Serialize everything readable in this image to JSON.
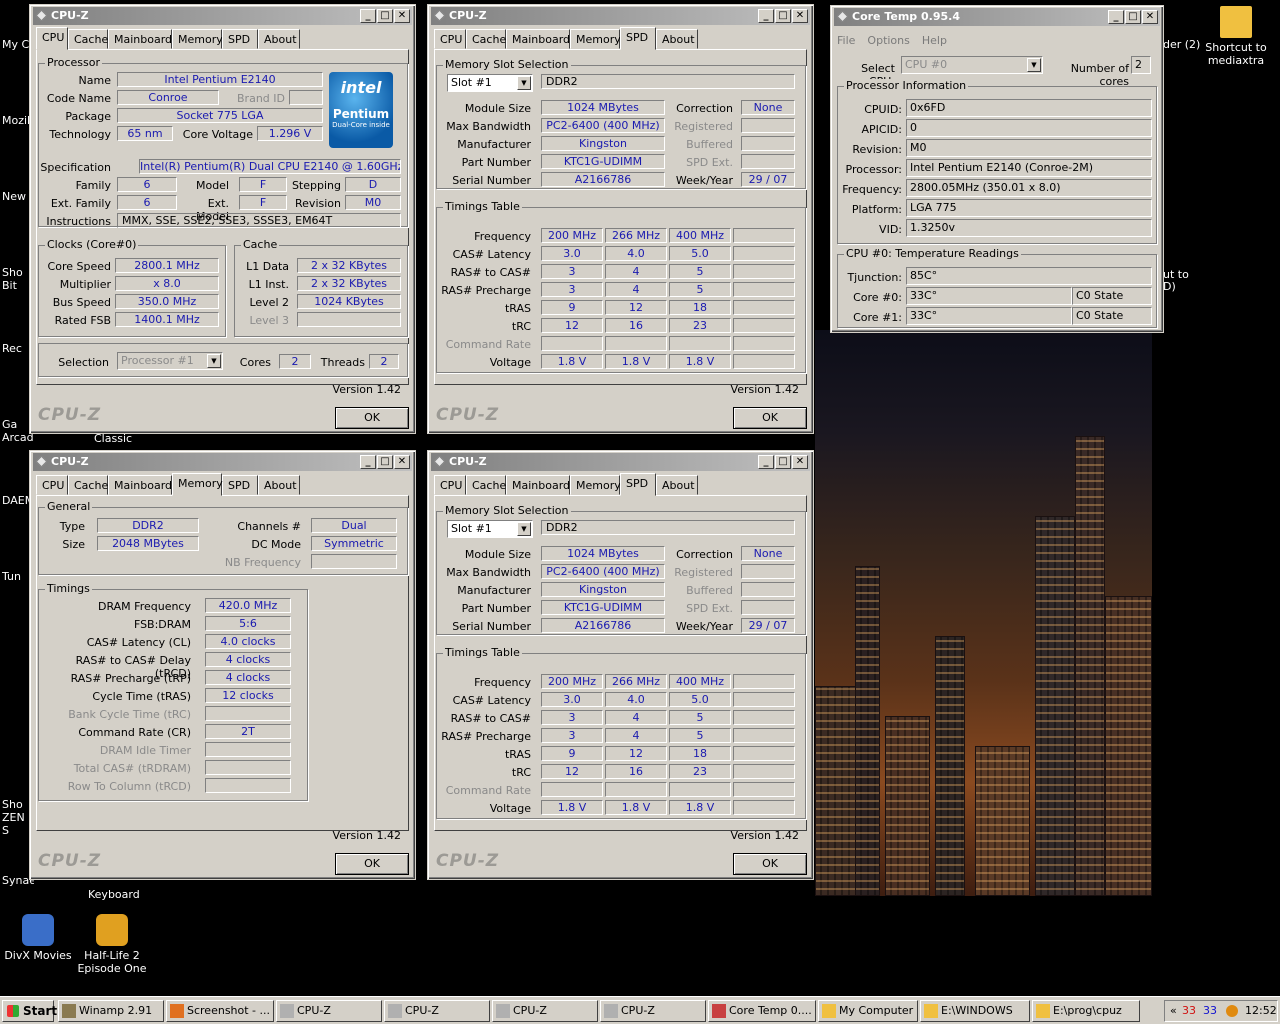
{
  "desktop": {
    "icons": [
      {
        "label": "Shortcut to mediaxtra",
        "icon": "folder-icon"
      },
      {
        "label": "DivX Movies",
        "icon": "divx-icon"
      },
      {
        "label": "Half-Life 2 Episode One",
        "icon": "halflife-icon"
      }
    ],
    "edge_left": [
      "My C",
      "Mozill",
      "New",
      "Sho Bit",
      "Rec",
      "Ga Arcade",
      "DAEM",
      "Tun",
      "Sho ZEN S",
      "Synaesthete"
    ],
    "partial": {
      "classic": "Classic",
      "keyboard": "Keyboard",
      "folder2": "der (2)",
      "shortcut_to": "ut to",
      "d": "D)"
    }
  },
  "cpuz_windows": [
    {
      "title": "CPU-Z",
      "active_tab": "CPU",
      "version": "Version 1.42",
      "brand": "CPU-Z",
      "ok": "OK"
    },
    {
      "title": "CPU-Z",
      "active_tab": "SPD",
      "version": "Version 1.42",
      "brand": "CPU-Z",
      "ok": "OK"
    },
    {
      "title": "CPU-Z",
      "active_tab": "Memory",
      "version": "Version 1.42",
      "brand": "CPU-Z",
      "ok": "OK"
    },
    {
      "title": "CPU-Z",
      "active_tab": "SPD",
      "version": "Version 1.42",
      "brand": "CPU-Z",
      "ok": "OK"
    }
  ],
  "tabs": [
    "CPU",
    "Cache",
    "Mainboard",
    "Memory",
    "SPD",
    "About"
  ],
  "cpu": {
    "processor_group": "Processor",
    "labels": {
      "name": "Name",
      "code_name": "Code Name",
      "brand_id": "Brand ID",
      "package": "Package",
      "technology": "Technology",
      "core_voltage": "Core Voltage",
      "specification": "Specification",
      "family": "Family",
      "model": "Model",
      "stepping": "Stepping",
      "ext_family": "Ext. Family",
      "ext_model": "Ext. Model",
      "revision": "Revision",
      "instructions": "Instructions"
    },
    "name": "Intel Pentium E2140",
    "code_name": "Conroe",
    "brand_id": "",
    "package": "Socket 775 LGA",
    "technology": "65 nm",
    "core_voltage": "1.296 V",
    "specification": "Intel(R) Pentium(R) Dual  CPU  E2140  @ 1.60GHz",
    "family": "6",
    "model": "F",
    "stepping": "D",
    "ext_family": "6",
    "ext_model": "F",
    "revision": "M0",
    "instructions": "MMX, SSE, SSE2, SSE3, SSSE3, EM64T",
    "logo": {
      "brand": "intel",
      "product": "Pentium",
      "sub": "Dual-Core inside"
    },
    "clocks_group": "Clocks (Core#0)",
    "clock_labels": {
      "core_speed": "Core Speed",
      "multiplier": "Multiplier",
      "bus_speed": "Bus Speed",
      "rated_fsb": "Rated FSB"
    },
    "core_speed": "2800.1 MHz",
    "multiplier": "x 8.0",
    "bus_speed": "350.0 MHz",
    "rated_fsb": "1400.1 MHz",
    "cache_group": "Cache",
    "cache_labels": {
      "l1_data": "L1 Data",
      "l1_inst": "L1 Inst.",
      "level2": "Level 2",
      "level3": "Level 3"
    },
    "l1_data": "2 x 32 KBytes",
    "l1_inst": "2 x 32 KBytes",
    "level2": "1024 KBytes",
    "level3": "",
    "selection_label": "Selection",
    "selection": "Processor #1",
    "cores_label": "Cores",
    "cores": "2",
    "threads_label": "Threads",
    "threads": "2"
  },
  "spd": {
    "slot_group": "Memory Slot Selection",
    "slot": "Slot #1",
    "type": "DDR2",
    "labels": {
      "module_size": "Module Size",
      "max_bandwidth": "Max Bandwidth",
      "manufacturer": "Manufacturer",
      "part_number": "Part Number",
      "serial_number": "Serial Number",
      "correction": "Correction",
      "registered": "Registered",
      "buffered": "Buffered",
      "spd_ext": "SPD Ext.",
      "week_year": "Week/Year"
    },
    "module_size": "1024 MBytes",
    "max_bandwidth": "PC2-6400 (400 MHz)",
    "manufacturer": "Kingston",
    "part_number": "KTC1G-UDIMM",
    "serial_number": "A2166786",
    "correction": "None",
    "week_year": "29 / 07",
    "timings_group": "Timings Table",
    "rows": [
      {
        "label": "Frequency",
        "vals": [
          "200 MHz",
          "266 MHz",
          "400 MHz",
          ""
        ]
      },
      {
        "label": "CAS# Latency",
        "vals": [
          "3.0",
          "4.0",
          "5.0",
          ""
        ]
      },
      {
        "label": "RAS# to CAS#",
        "vals": [
          "3",
          "4",
          "5",
          ""
        ]
      },
      {
        "label": "RAS# Precharge",
        "vals": [
          "3",
          "4",
          "5",
          ""
        ]
      },
      {
        "label": "tRAS",
        "vals": [
          "9",
          "12",
          "18",
          ""
        ]
      },
      {
        "label": "tRC",
        "vals": [
          "12",
          "16",
          "23",
          ""
        ]
      },
      {
        "label": "Command Rate",
        "vals": [
          "",
          "",
          "",
          ""
        ],
        "disabled": true
      },
      {
        "label": "Voltage",
        "vals": [
          "1.8 V",
          "1.8 V",
          "1.8 V",
          ""
        ]
      }
    ]
  },
  "memory": {
    "general_group": "General",
    "labels": {
      "type": "Type",
      "size": "Size",
      "channels": "Channels #",
      "dc_mode": "DC Mode",
      "nb_frequency": "NB Frequency"
    },
    "type": "DDR2",
    "size": "2048 MBytes",
    "channels": "Dual",
    "dc_mode": "Symmetric",
    "nb_frequency": "",
    "timings_group": "Timings",
    "rows": [
      {
        "label": "DRAM Frequency",
        "val": "420.0 MHz"
      },
      {
        "label": "FSB:DRAM",
        "val": "5:6"
      },
      {
        "label": "CAS# Latency (CL)",
        "val": "4.0 clocks"
      },
      {
        "label": "RAS# to CAS# Delay (tRCD)",
        "val": "4 clocks"
      },
      {
        "label": "RAS# Precharge (tRP)",
        "val": "4 clocks"
      },
      {
        "label": "Cycle Time (tRAS)",
        "val": "12 clocks"
      },
      {
        "label": "Bank Cycle Time (tRC)",
        "val": "",
        "disabled": true
      },
      {
        "label": "Command Rate (CR)",
        "val": "2T"
      },
      {
        "label": "DRAM Idle Timer",
        "val": "",
        "disabled": true
      },
      {
        "label": "Total CAS# (tRDRAM)",
        "val": "",
        "disabled": true
      },
      {
        "label": "Row To Column (tRCD)",
        "val": "",
        "disabled": true
      }
    ]
  },
  "coretemp": {
    "title": "Core Temp 0.95.4",
    "menu": [
      "File",
      "Options",
      "Help"
    ],
    "select_cpu_label": "Select CPU:",
    "select_cpu": "CPU #0",
    "num_cores_label": "Number of cores",
    "num_cores": "2",
    "info_group": "Processor Information",
    "info": [
      {
        "label": "CPUID:",
        "val": "0x6FD"
      },
      {
        "label": "APICID:",
        "val": "0"
      },
      {
        "label": "Revision:",
        "val": "M0"
      },
      {
        "label": "Processor:",
        "val": "Intel Pentium E2140 (Conroe-2M)"
      },
      {
        "label": "Frequency:",
        "val": "2800.05MHz (350.01 x 8.0)"
      },
      {
        "label": "Platform:",
        "val": "LGA 775"
      },
      {
        "label": "VID:",
        "val": "1.3250v"
      }
    ],
    "temp_group": "CPU #0: Temperature Readings",
    "tjunction_label": "Tjunction:",
    "tjunction": "85C°",
    "cores": [
      {
        "label": "Core #0:",
        "temp": "33C°",
        "state": "C0 State"
      },
      {
        "label": "Core #1:",
        "temp": "33C°",
        "state": "C0 State"
      }
    ]
  },
  "taskbar": {
    "start": "Start",
    "tasks": [
      {
        "label": "Winamp 2.91",
        "icon": "winamp-icon"
      },
      {
        "label": "Screenshot - ...",
        "icon": "firefox-icon"
      },
      {
        "label": "CPU-Z",
        "icon": "cpuz-icon"
      },
      {
        "label": "CPU-Z",
        "icon": "cpuz-icon"
      },
      {
        "label": "CPU-Z",
        "icon": "cpuz-icon"
      },
      {
        "label": "CPU-Z",
        "icon": "cpuz-icon"
      },
      {
        "label": "Core Temp 0....",
        "icon": "coretemp-icon"
      },
      {
        "label": "My Computer",
        "icon": "folder-icon"
      },
      {
        "label": "E:\\WINDOWS",
        "icon": "folder-icon"
      },
      {
        "label": "E:\\prog\\cpuz",
        "icon": "folder-icon"
      }
    ],
    "tray": {
      "arrows": "«",
      "t1": "33",
      "t2": "33",
      "time": "12:52"
    }
  }
}
